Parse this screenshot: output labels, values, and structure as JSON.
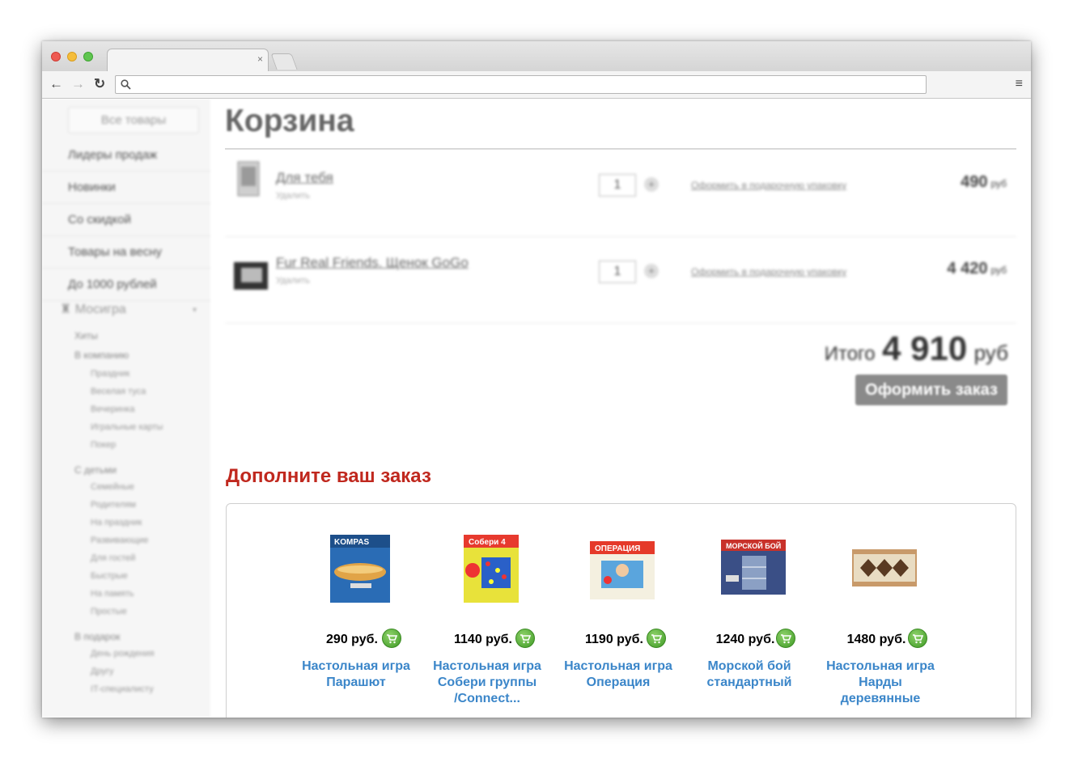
{
  "browser": {
    "tab_title": "",
    "tab_close": "×",
    "url": "",
    "search_icon": "search-icon",
    "back": "←",
    "forward": "→",
    "reload": "↻",
    "menu": "≡"
  },
  "sidebar": {
    "all_products": "Все товары",
    "items": [
      "Лидеры продаж",
      "Новинки",
      "Со скидкой",
      "Товары на весну",
      "До 1000 рублей"
    ],
    "brand": "Мосигра",
    "groups": [
      {
        "label": "Хиты",
        "items": []
      },
      {
        "label": "В компанию",
        "items": [
          "Праздник",
          "Веселая туса",
          "Вечеринка",
          "Игральные карты",
          "Покер"
        ]
      },
      {
        "label": "С детьми",
        "items": [
          "Семейные",
          "Родителям",
          "На праздник",
          "Развивающие",
          "Для гостей",
          "Быстрые",
          "На память",
          "Простые"
        ]
      },
      {
        "label": "В подарок",
        "items": [
          "День рождения",
          "Другу",
          "IT-специалисту"
        ]
      }
    ]
  },
  "cart": {
    "title": "Корзина",
    "items": [
      {
        "name": "Для тебя",
        "remove": "Удалить",
        "qty": "1",
        "plus": "+",
        "gift": "Оформить в подарочную упаковку",
        "price": "490",
        "unit": "руб"
      },
      {
        "name": "Fur Real Friends. Щенок GoGo",
        "remove": "Удалить",
        "qty": "1",
        "plus": "+",
        "gift": "Оформить в подарочную упаковку",
        "price": "4 420",
        "unit": "руб"
      }
    ],
    "total_label": "Итого",
    "total_value": "4 910",
    "total_unit": "руб",
    "order_button": "Оформить заказ"
  },
  "upsell": {
    "title": "Дополните ваш заказ",
    "products": [
      {
        "price": "290 руб.",
        "name": "Настольная игра Парашют"
      },
      {
        "price": "1140 руб.",
        "name": "Настольная игра Собери группы /Connect..."
      },
      {
        "price": "1190 руб.",
        "name": "Настольная игра Операция"
      },
      {
        "price": "1240 руб.",
        "name": "Морской бой стандартный"
      },
      {
        "price": "1480 руб.",
        "name": "Настольная игра Нарды деревянные"
      }
    ]
  },
  "colors": {
    "accent_red": "#c0281e",
    "link_blue": "#3b86c9",
    "cart_green": "#3e9a25"
  }
}
